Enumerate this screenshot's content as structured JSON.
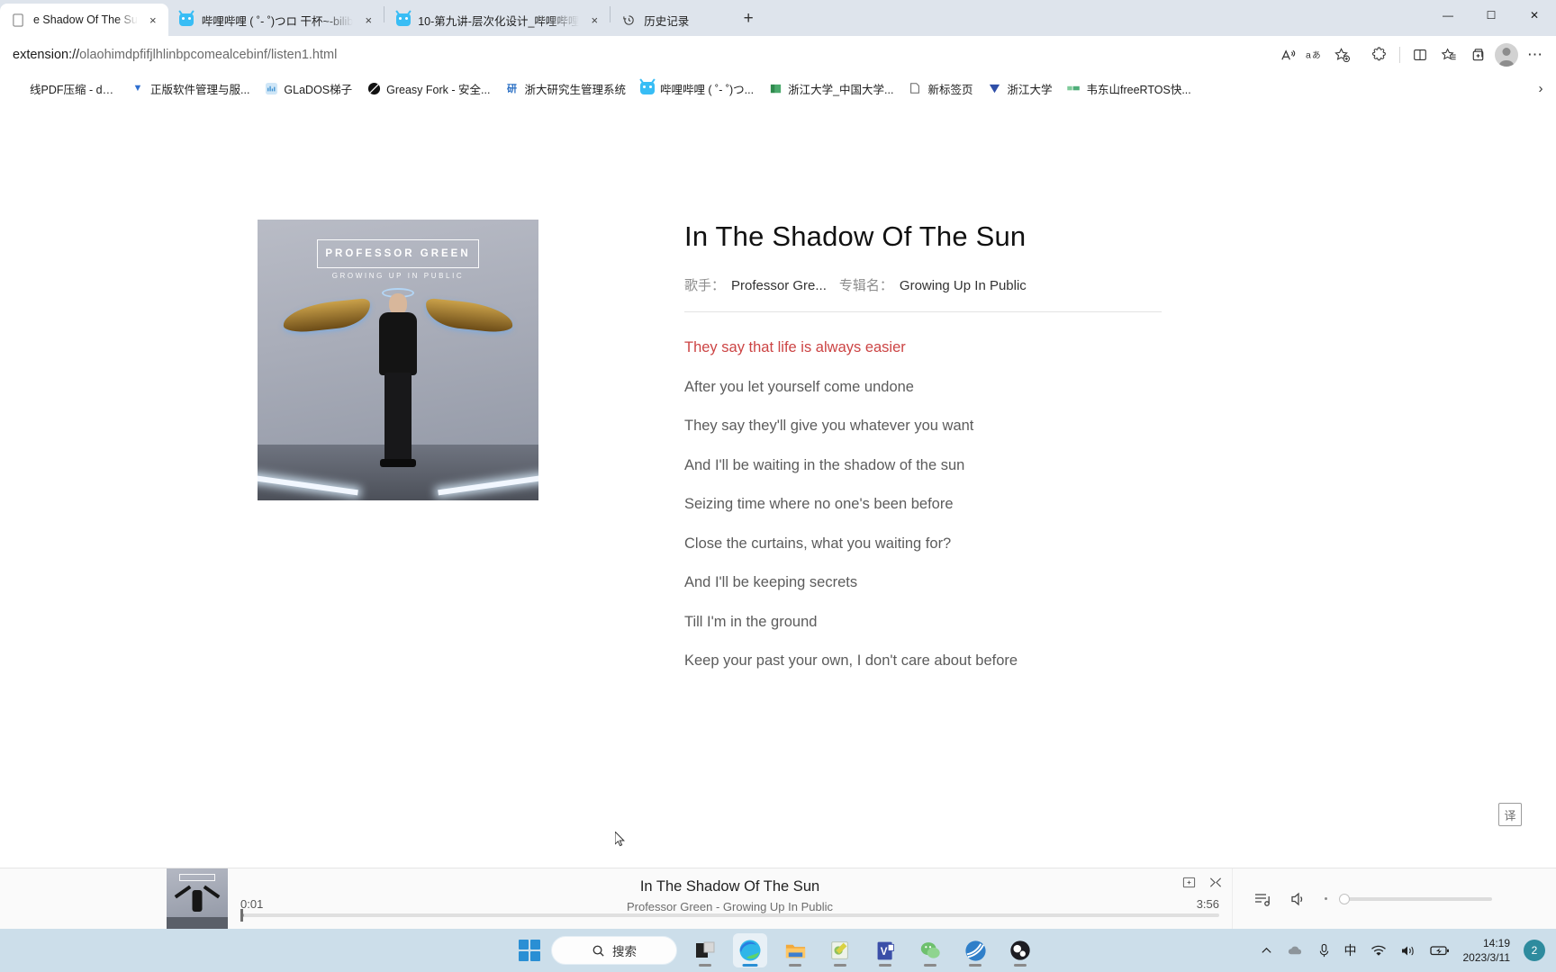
{
  "browser": {
    "tabs": [
      {
        "title": "e Shadow Of The Su",
        "icon": "page-icon",
        "active": true,
        "close_label": "×"
      },
      {
        "title": "哔哩哔哩 ( ˚- ˚)つロ 干杯~-bilib",
        "icon": "bilibili-icon",
        "active": false,
        "close_label": "×"
      },
      {
        "title": "10-第九讲-层次化设计_哔哩哔哩",
        "icon": "bilibili-icon",
        "active": false,
        "close_label": "×"
      },
      {
        "title": "历史记录",
        "icon": "history-icon",
        "active": false,
        "close_label": "×"
      }
    ],
    "new_tab_label": "+",
    "window_controls": {
      "minimize": "—",
      "maximize": "☐",
      "close": "✕"
    },
    "address": {
      "prefix": "extension://",
      "path": "olaohimdpfifjlhlinbpcomealcebinf/listen1.html"
    },
    "toolbar_icons": [
      "read-aloud-icon",
      "translate-page-icon",
      "add-favorite-icon",
      "extensions-icon",
      "split-screen-icon",
      "favorites-icon",
      "collections-icon",
      "profile-avatar-icon",
      "settings-more-icon"
    ],
    "bookmarks": [
      {
        "label": "线PDF压缩 - docs...",
        "icon": "pdf-icon"
      },
      {
        "label": "正版软件管理与服...",
        "icon": "dropdown-icon"
      },
      {
        "label": "GLaDOS梯子",
        "icon": "glados-icon"
      },
      {
        "label": "Greasy Fork - 安全...",
        "icon": "greasyfork-icon"
      },
      {
        "label": "浙大研究生管理系统",
        "icon": "zju-grad-icon"
      },
      {
        "label": "哔哩哔哩 ( ˚- ˚)つ...",
        "icon": "bilibili-icon"
      },
      {
        "label": "浙江大学_中国大学...",
        "icon": "book-icon"
      },
      {
        "label": "新标签页",
        "icon": "newtab-icon"
      },
      {
        "label": "浙江大学",
        "icon": "zju-icon"
      },
      {
        "label": "韦东山freeRTOS快...",
        "icon": "freertos-icon"
      }
    ],
    "bookmarks_overflow": "›"
  },
  "song": {
    "title": "In The Shadow Of The Sun",
    "artist_label": "歌手：",
    "artist_value": "Professor Gre...",
    "album_label": "专辑名：",
    "album_value": "Growing Up In Public",
    "album_art": {
      "artist_name": "PROFESSOR GREEN",
      "album_name": "GROWING UP IN PUBLIC"
    },
    "lyrics": [
      {
        "text": "They say that life is always easier",
        "active": true
      },
      {
        "text": "After you let yourself come undone",
        "active": false
      },
      {
        "text": "They say they'll give you whatever you want",
        "active": false
      },
      {
        "text": "And I'll be waiting in the shadow of the sun",
        "active": false
      },
      {
        "text": "Seizing time where no one's been before",
        "active": false
      },
      {
        "text": "Close the curtains, what you waiting for?",
        "active": false
      },
      {
        "text": "And I'll be keeping secrets",
        "active": false
      },
      {
        "text": "Till I'm in the ground",
        "active": false
      },
      {
        "text": "Keep your past your own, I don't care about before",
        "active": false
      }
    ],
    "active_lyric_color": "#cc4444"
  },
  "translate_button": {
    "label": "译"
  },
  "player": {
    "title": "In The Shadow Of The Sun",
    "subtitle": "Professor Green - Growing Up In Public",
    "current_time": "0:01",
    "total_time": "3:56",
    "progress_percent": 0.4,
    "volume_percent": 0,
    "icons": [
      "add-to-playlist-icon",
      "shuffle-icon",
      "playlist-icon",
      "volume-icon"
    ]
  },
  "taskbar": {
    "start_label": "start-icon",
    "search_placeholder": "搜索",
    "apps": [
      {
        "name": "task-view-icon",
        "active": false
      },
      {
        "name": "edge-browser-icon",
        "active": true
      },
      {
        "name": "file-explorer-icon",
        "active": false
      },
      {
        "name": "notepad-icon",
        "active": false
      },
      {
        "name": "visio-icon",
        "active": false
      },
      {
        "name": "wechat-icon",
        "active": false
      },
      {
        "name": "network-app-icon",
        "active": false
      },
      {
        "name": "obs-icon",
        "active": false
      }
    ],
    "tray_icons": [
      "chevron-up-icon",
      "onedrive-icon",
      "microphone-icon",
      "ime-chinese-icon",
      "wifi-icon",
      "speaker-icon",
      "battery-icon"
    ],
    "ime_label": "中",
    "time": "14:19",
    "date": "2023/3/11",
    "notification_count": "2"
  }
}
